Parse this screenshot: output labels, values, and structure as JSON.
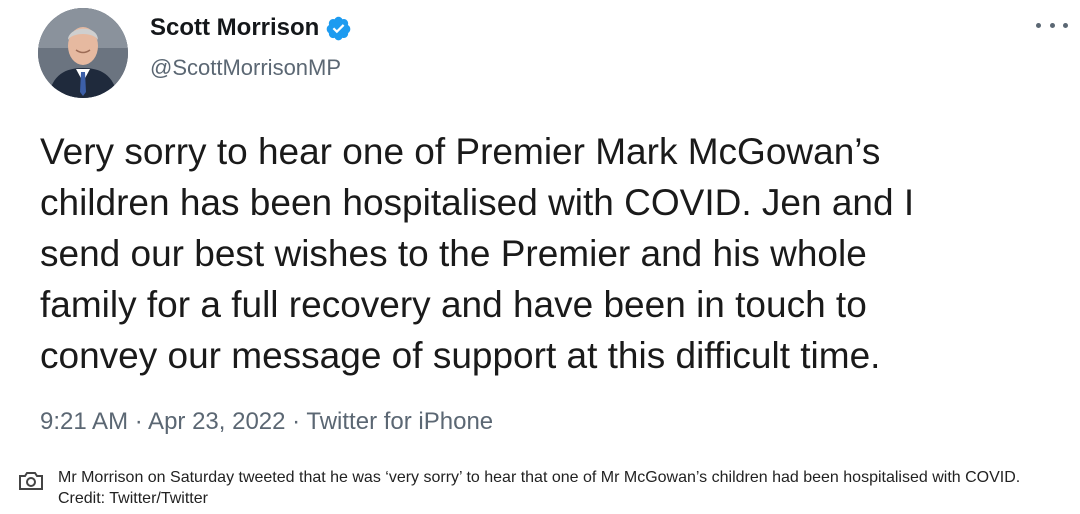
{
  "tweet": {
    "author_name": "Scott Morrison",
    "author_handle": "@ScottMorrisonMP",
    "text": "Very sorry to hear one of Premier Mark McGowan’s\nchildren has been hospitalised with COVID. Jen and I\nsend our best wishes to the Premier and his whole\nfamily for a full recovery and have been in touch to\nconvey our message of support at this difficult time.",
    "meta": "9:21 AM · Apr 23, 2022 · Twitter for iPhone",
    "verified": true,
    "icons": [
      "verified-badge-icon",
      "more-options-icon"
    ]
  },
  "caption": {
    "icon": "camera-icon",
    "text": "Mr Morrison on Saturday tweeted that he was ‘very sorry’ to hear that one of Mr McGowan’s children had been hospitalised with COVID. Credit: Twitter/Twitter"
  },
  "colors": {
    "verified_blue": "#1d9bf0",
    "text": "#1a1a1a",
    "secondary": "#5b6773"
  }
}
